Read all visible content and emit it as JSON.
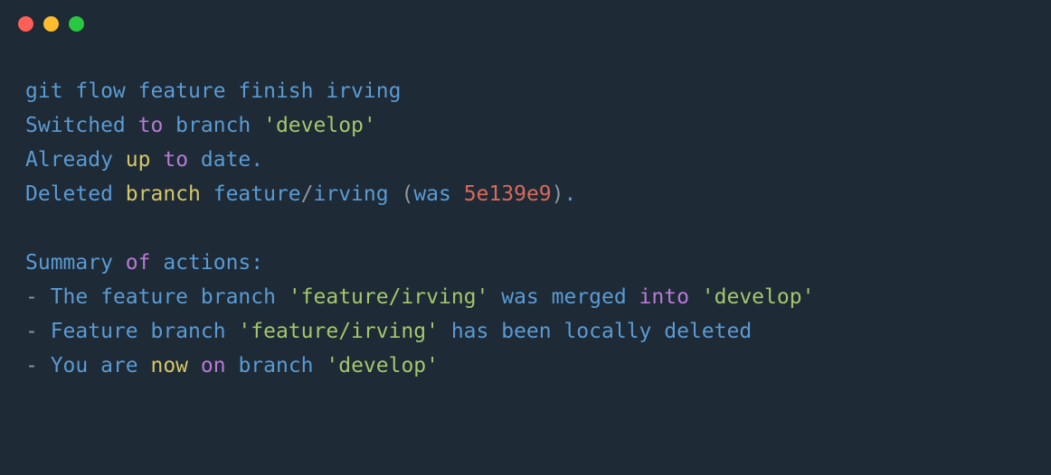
{
  "titlebar": {
    "close": "close",
    "minimize": "minimize",
    "zoom": "zoom"
  },
  "lines": {
    "l1": {
      "t1": "git flow feature finish irving"
    },
    "l2": {
      "t1": "Switched ",
      "t2": "to",
      "t3": " branch ",
      "t4": "'develop'"
    },
    "l3": {
      "t1": "Already ",
      "t2": "up",
      "t3": " ",
      "t4": "to",
      "t5": " date."
    },
    "l4": {
      "t1": "Deleted ",
      "t2": "branch",
      "t3": " feature",
      "t4": "/",
      "t5": "irving ",
      "t6": "(",
      "t7": "was ",
      "t8": "5e139e9",
      "t9": ")",
      "t10": "."
    },
    "l5": {
      "t1": "Summary ",
      "t2": "of",
      "t3": " actions:"
    },
    "l6": {
      "t1": "- ",
      "t2": "The feature branch ",
      "t3": "'feature/irving'",
      "t4": " was merged ",
      "t5": "into",
      "t6": " ",
      "t7": "'develop'"
    },
    "l7": {
      "t1": "- ",
      "t2": "Feature branch ",
      "t3": "'feature/irving'",
      "t4": " has been locally deleted"
    },
    "l8": {
      "t1": "- ",
      "t2": "You are ",
      "t3": "now",
      "t4": " ",
      "t5": "on",
      "t6": " branch ",
      "t7": "'develop'"
    }
  }
}
